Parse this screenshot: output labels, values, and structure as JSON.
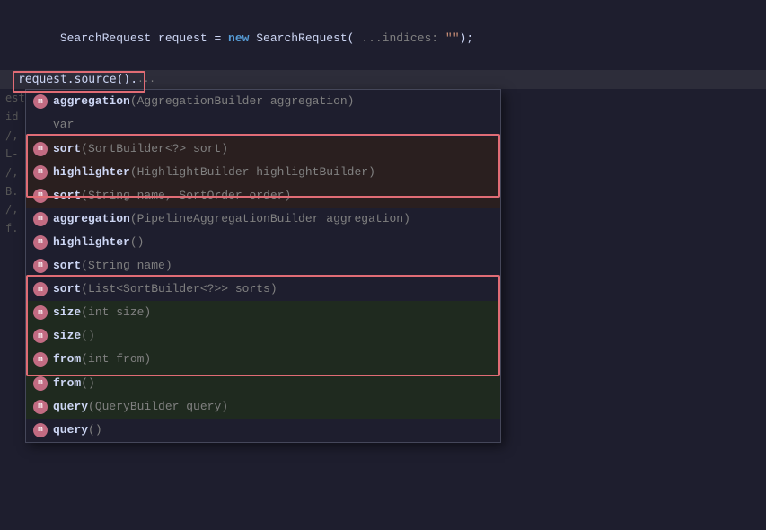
{
  "editor": {
    "line1": {
      "text_before_new": "SearchRequest request = ",
      "kw_new": "new",
      "text_after": " SearchRequest( ",
      "param": "...indices: \"\"",
      "end": ");"
    },
    "cursor_line": "request.source().",
    "cursor_hint": "...",
    "side_labels": [
      "est",
      "id",
      "/,",
      "L-",
      "/,",
      "B.",
      "/,",
      "f."
    ]
  },
  "autocomplete": {
    "items": [
      {
        "type": "m",
        "name": "aggregation",
        "params": "(AggregationBuilder aggregation)"
      },
      {
        "type": "var",
        "name": "var",
        "params": ""
      },
      {
        "type": "m",
        "name": "sort",
        "params": "(SortBuilder<?> sort)",
        "highlighted": true
      },
      {
        "type": "m",
        "name": "highlighter",
        "params": "(HighlightBuilder highlightBuilder)",
        "highlighted": true
      },
      {
        "type": "m",
        "name": "sort",
        "params": "(String name, SortOrder order)",
        "highlighted": true
      },
      {
        "type": "m",
        "name": "aggregation",
        "params": "(PipelineAggregationBuilder aggregation)"
      },
      {
        "type": "m",
        "name": "highlighter",
        "params": "()"
      },
      {
        "type": "m",
        "name": "sort",
        "params": "(String name)"
      },
      {
        "type": "m",
        "name": "sort",
        "params": "(List<SortBuilder<?>> sorts)"
      },
      {
        "type": "m",
        "name": "size",
        "params": "(int size)",
        "highlighted2": true
      },
      {
        "type": "m",
        "name": "size",
        "params": "()",
        "highlighted2": true
      },
      {
        "type": "m",
        "name": "from",
        "params": "(int from)",
        "highlighted2": true
      },
      {
        "type": "m",
        "name": "from",
        "params": "()",
        "highlighted2": true
      },
      {
        "type": "m",
        "name": "query",
        "params": "(QueryBuilder query)",
        "highlighted2": true
      },
      {
        "type": "m",
        "name": "query",
        "params": "()"
      }
    ]
  },
  "colors": {
    "red_border": "#e06c75",
    "method_icon_bg": "#c26b82",
    "keyword_color": "#569cd6",
    "type_color": "#4ec9b0",
    "param_color": "#808080",
    "highlight_bg": "#3a2a2a",
    "normal_bg": "#1e1e2e",
    "var_color": "#808080"
  }
}
